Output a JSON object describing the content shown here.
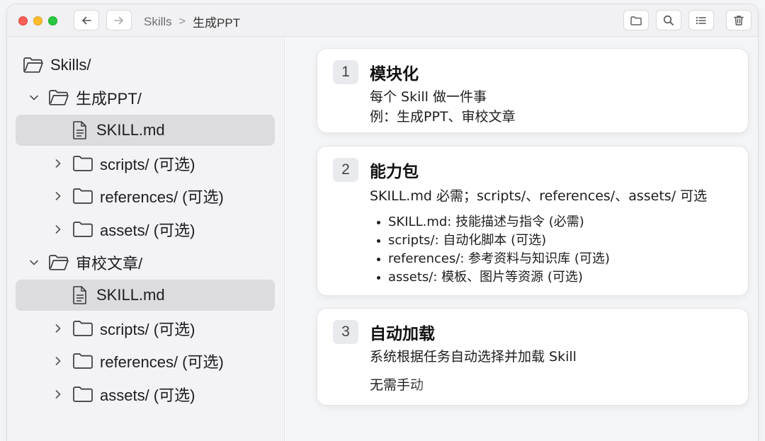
{
  "titlebar": {
    "breadcrumb": [
      "Skills",
      "生成PPT"
    ],
    "breadcrumb_separator": ">",
    "icons": [
      "back-arrow-icon",
      "forward-arrow-icon",
      "folder-icon",
      "search-icon",
      "list-icon",
      "trash-icon"
    ]
  },
  "sidebar": {
    "root": "Skills/",
    "groups": [
      {
        "folder": "生成PPT/",
        "file": "SKILL.md",
        "subfolders": [
          "scripts/ (可选)",
          "references/ (可选)",
          "assets/ (可选)"
        ]
      },
      {
        "folder": "审校文章/",
        "file": "SKILL.md",
        "subfolders": [
          "scripts/ (可选)",
          "references/ (可选)",
          "assets/ (可选)"
        ]
      }
    ]
  },
  "cards": [
    {
      "number": "1",
      "title": "模块化",
      "lines": [
        "每个 Skill 做一件事",
        "例：生成PPT、审校文章"
      ]
    },
    {
      "number": "2",
      "title": "能力包",
      "lines": [
        "SKILL.md 必需；scripts/、references/、assets/ 可选"
      ],
      "bullets": [
        "SKILL.md: 技能描述与指令 (必需)",
        "scripts/: 自动化脚本 (可选)",
        "references/: 参考资料与知识库 (可选)",
        "assets/: 模板、图片等资源 (可选)"
      ]
    },
    {
      "number": "3",
      "title": "自动加载",
      "lines": [
        "系统根据任务自动选择并加载 Skill",
        "无需手动"
      ]
    }
  ],
  "colors": {
    "selected_row": "#dcdce0",
    "sidebar_bg": "#f3f3f5",
    "number_badge": "#e9eaee",
    "close": "#fe5f57",
    "minimize": "#febc2e",
    "zoom": "#28c840"
  }
}
